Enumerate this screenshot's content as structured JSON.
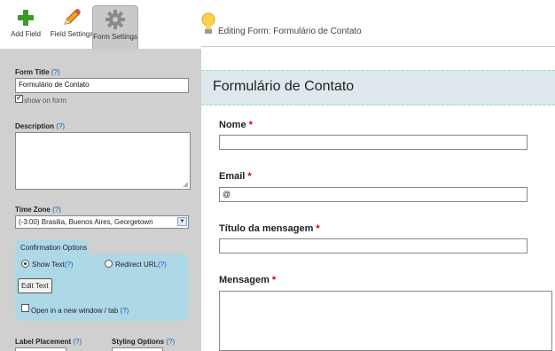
{
  "toolbar": {
    "add_field": "Add Field",
    "field_settings": "Field Settings",
    "form_settings": "Form Settings"
  },
  "editing_label": "Editing Form: Formulário de Contato",
  "settings": {
    "form_title_label": "Form Title",
    "help": "(?)",
    "form_title_value": "Formulário de Contato",
    "show_on_form": "show on form",
    "description_label": "Description",
    "timezone_label": "Time Zone",
    "timezone_value": "(-3:00) Brasilia, Buenos Aires, Georgetown",
    "confirmation_tab": "Confirmation Options",
    "show_text": "Show Text",
    "redirect_url": "Redirect URL",
    "edit_text": "Edit Text",
    "new_window": "Open in a new window / tab",
    "label_placement": "Label Placement",
    "styling_options": "Styling Options"
  },
  "form": {
    "title": "Formulário de Contato",
    "required_mark": "*",
    "fields": [
      {
        "label": "Nome",
        "value": ""
      },
      {
        "label": "Email",
        "value": "@"
      },
      {
        "label": "Título da mensagem",
        "value": ""
      },
      {
        "label": "Mensagem",
        "value": ""
      }
    ]
  },
  "colors": {
    "panel_bg": "#d0d0d0",
    "confirm_bg": "#add8e6",
    "form_header_bg": "#dee8ed",
    "required": "#cc0000",
    "link": "#1a5dbf"
  }
}
